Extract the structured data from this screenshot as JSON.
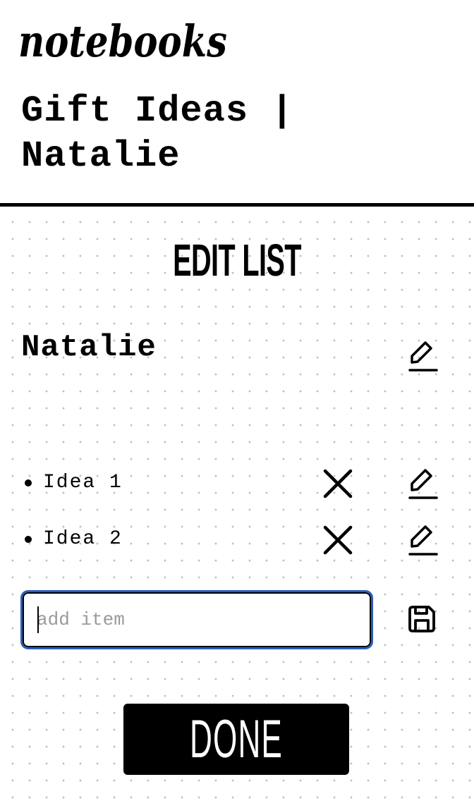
{
  "app": {
    "logo_text": "notebooks",
    "list_title": "Gift Ideas | Natalie"
  },
  "editor": {
    "heading": "EDIT LIST",
    "owner_name": "Natalie",
    "items": [
      {
        "text": "Idea 1"
      },
      {
        "text": "Idea 2"
      }
    ],
    "add_item": {
      "placeholder": "add item",
      "value": ""
    },
    "done_label": "DONE"
  },
  "icons": {
    "edit": "pencil-icon",
    "remove": "close-icon",
    "save": "floppy-disk-icon"
  },
  "colors": {
    "ink": "#000000",
    "background": "#ffffff",
    "focus_ring": "#2b5cb8",
    "placeholder": "#9a9a9a",
    "grid_dot": "#bdbdbd"
  }
}
